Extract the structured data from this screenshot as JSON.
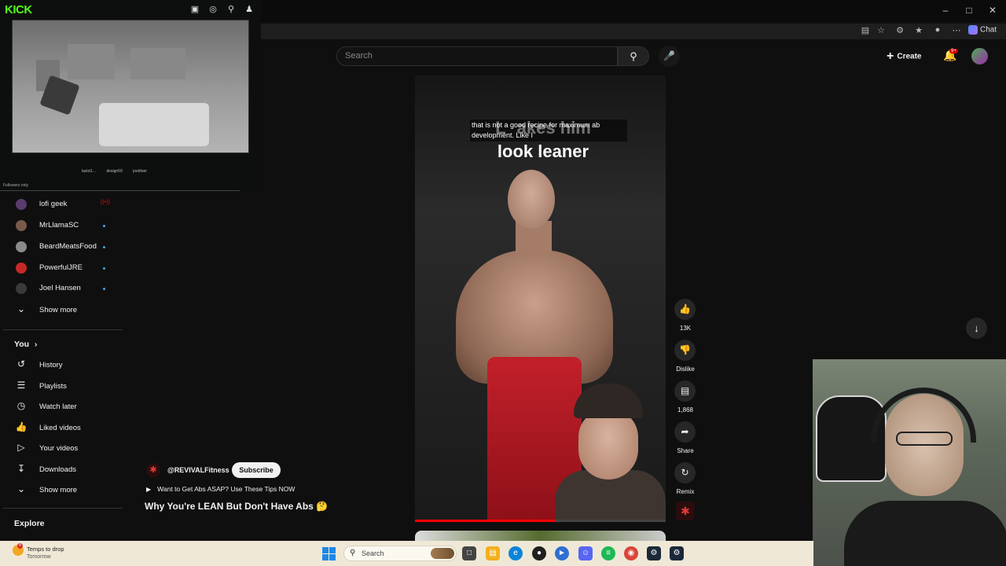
{
  "kick": {
    "logo": "KICK",
    "chatters": [
      "lazizi1...",
      "design59",
      "joeldoer"
    ],
    "followers_only": "Followers only",
    "icons": [
      "gift-icon",
      "globe-icon",
      "search-icon",
      "user-icon"
    ]
  },
  "browser": {
    "chat_label": "Chat",
    "window_controls": [
      "minimize",
      "maximize",
      "close"
    ]
  },
  "header": {
    "search_placeholder": "Search",
    "create_label": "Create",
    "notification_count": "9+"
  },
  "sidebar": {
    "subscriptions": [
      {
        "name": "lofi geek",
        "status": "live",
        "avatar_color": "#5a3b6e"
      },
      {
        "name": "MrLlamaSC",
        "status": "new",
        "avatar_color": "#7a5a4a"
      },
      {
        "name": "BeardMeatsFood",
        "status": "new",
        "avatar_color": "#8a8a8a"
      },
      {
        "name": "PowerfulJRE",
        "status": "new",
        "avatar_color": "#c62828"
      },
      {
        "name": "Joel Hansen",
        "status": "new",
        "avatar_color": "#3a3a3a"
      }
    ],
    "show_more_1": "Show more",
    "you_label": "You",
    "you_items": [
      {
        "label": "History",
        "icon": "history-icon"
      },
      {
        "label": "Playlists",
        "icon": "playlists-icon"
      },
      {
        "label": "Watch later",
        "icon": "watch-later-icon"
      },
      {
        "label": "Liked videos",
        "icon": "thumbs-up-icon"
      },
      {
        "label": "Your videos",
        "icon": "play-square-icon"
      },
      {
        "label": "Downloads",
        "icon": "download-icon"
      }
    ],
    "show_more_2": "Show more",
    "explore_label": "Explore"
  },
  "short": {
    "caption": "Lo ...ally makes him look leaner",
    "caption_visible": "L      akes him\nlook leaner",
    "subtitle": "that is not a good recipe for maximum ab development. Like I",
    "progress": 0.56,
    "actions": {
      "like_count": "13K",
      "dislike_label": "Dislike",
      "comment_count": "1,868",
      "share_label": "Share",
      "remix_label": "Remix"
    },
    "channel": "@REVIVALFitness",
    "subscribe_label": "Subscribe",
    "related_video": "Want to Get Abs ASAP? Use These Tips NOW",
    "title": "Why You're LEAN But Don't Have Abs 🤔"
  },
  "taskbar": {
    "weather_title": "Temps to drop",
    "weather_sub": "Tomorrow",
    "weather_badge": "4",
    "search_label": "Search"
  }
}
